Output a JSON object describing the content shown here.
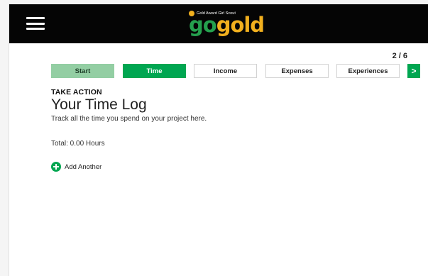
{
  "header": {
    "menu_icon": "hamburger-menu-icon",
    "logo_tagline": "Gold Award Girl Scout",
    "logo_word_part1": "go",
    "logo_word_part2": "gold",
    "logo_colors": {
      "go": "#25a14e",
      "gold": "#f2b01e"
    }
  },
  "progress": {
    "text": "2 / 6",
    "current": 2,
    "total": 6
  },
  "steps": [
    {
      "label": "Start",
      "state": "done"
    },
    {
      "label": "Time",
      "state": "active"
    },
    {
      "label": "Income",
      "state": "default"
    },
    {
      "label": "Expenses",
      "state": "default"
    },
    {
      "label": "Experiences",
      "state": "default"
    }
  ],
  "next_step": {
    "icon": "chevron-right-icon",
    "glyph": ">"
  },
  "content": {
    "section_label": "TAKE ACTION",
    "title": "Your Time Log",
    "subtitle": "Track all the time you spend on your project here.",
    "total": "Total: 0.00 Hours",
    "add_label": "Add Another"
  },
  "colors": {
    "header_bg": "#050505",
    "active_step": "#00a651",
    "done_step": "#93cea3",
    "accent": "#00a651"
  }
}
